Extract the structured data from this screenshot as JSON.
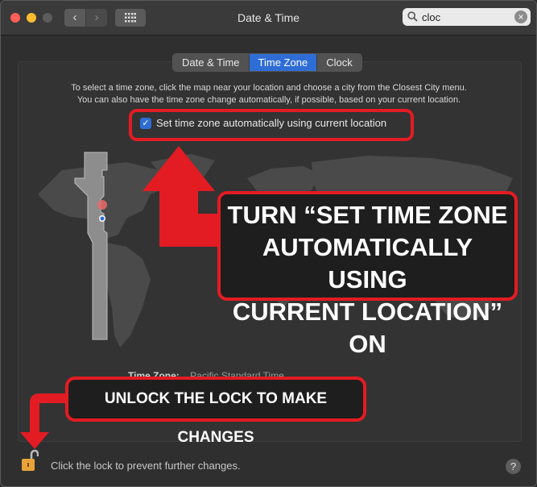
{
  "window": {
    "title": "Date & Time"
  },
  "toolbar": {
    "back_glyph": "‹",
    "forward_glyph": "›",
    "search_value": "cloc"
  },
  "tabs": [
    {
      "label": "Date & Time",
      "active": false
    },
    {
      "label": "Time Zone",
      "active": true
    },
    {
      "label": "Clock",
      "active": false
    }
  ],
  "timezone_pane": {
    "description_line1": "To select a time zone, click the map near your location and choose a city from the Closest City menu.",
    "description_line2": "You can also have the time zone change automatically, if possible, based on your current location.",
    "auto_checkbox_label": "Set time zone automatically using current location",
    "auto_checkbox_checked": true,
    "tz_label": "Time Zone:",
    "tz_value": "Pacific Standard Time"
  },
  "annotations": {
    "main_line1": "TURN “SET TIME ZONE",
    "main_line2": "AUTOMATICALLY USING",
    "main_line3": "CURRENT LOCATION” ON",
    "lock_note": "UNLOCK THE LOCK TO MAKE CHANGES"
  },
  "footer": {
    "lock_text": "Click the lock to prevent further changes.",
    "help_glyph": "?"
  },
  "colors": {
    "accent_blue": "#2f6dd6",
    "annotation_red": "#e31b23",
    "lock_orange": "#e8a33a"
  }
}
